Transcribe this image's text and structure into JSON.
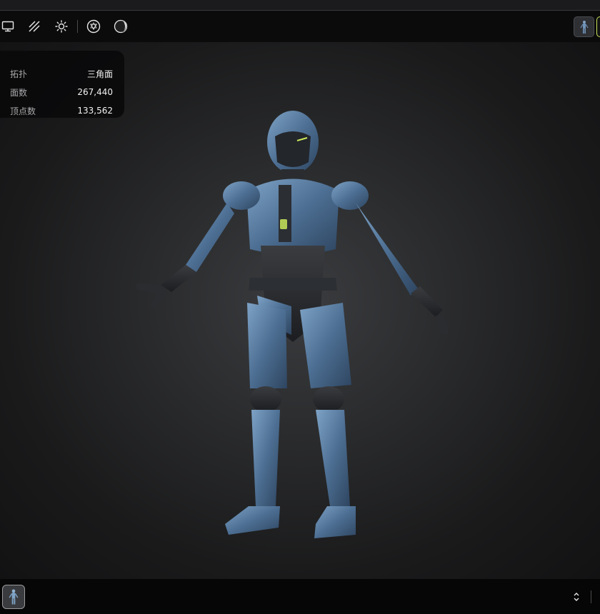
{
  "stats": {
    "rows": [
      {
        "label": "拓扑",
        "value": "三角面"
      },
      {
        "label": "面数",
        "value": "267,440"
      },
      {
        "label": "顶点数",
        "value": "133,562"
      }
    ]
  },
  "toolbar": {
    "icons": [
      "monitor-icon",
      "wireframe-icon",
      "light-icon",
      "environment-icon",
      "material-sphere-icon"
    ]
  },
  "colors": {
    "accent": "#c9e85a",
    "armor": "#5a7ea3",
    "background": "#2a2b2d"
  }
}
